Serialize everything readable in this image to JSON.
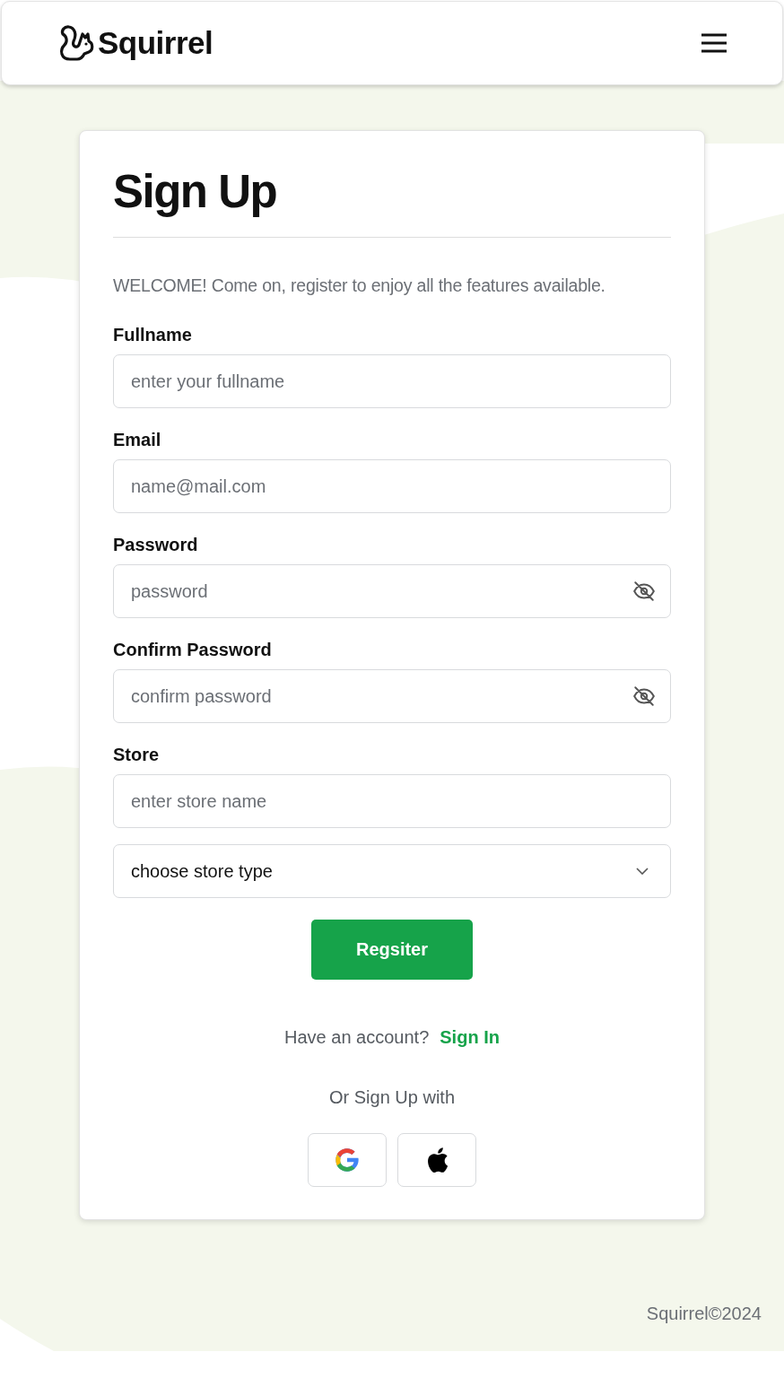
{
  "header": {
    "brand": "Squirrel"
  },
  "form": {
    "title": "Sign Up",
    "intro": "WELCOME! Come on, register to enjoy all the features available.",
    "fields": [
      {
        "kind": "text",
        "label": "Fullname",
        "placeholder": "enter your fullname"
      },
      {
        "kind": "text",
        "label": "Email",
        "placeholder": "name@mail.com"
      },
      {
        "kind": "password",
        "label": "Password",
        "placeholder": "password"
      },
      {
        "kind": "password",
        "label": "Confirm Password",
        "placeholder": "confirm password"
      },
      {
        "kind": "text",
        "label": "Store",
        "placeholder": "enter store name"
      },
      {
        "kind": "select",
        "value": "choose store type"
      }
    ],
    "submit": "Regsiter",
    "signin_prompt": "Have an account?",
    "signin_link": "Sign In",
    "social_label": "Or Sign Up with",
    "social": [
      {
        "kind": "google"
      },
      {
        "kind": "apple"
      }
    ]
  },
  "footer": {
    "copyright": "Squirrel©2024"
  }
}
